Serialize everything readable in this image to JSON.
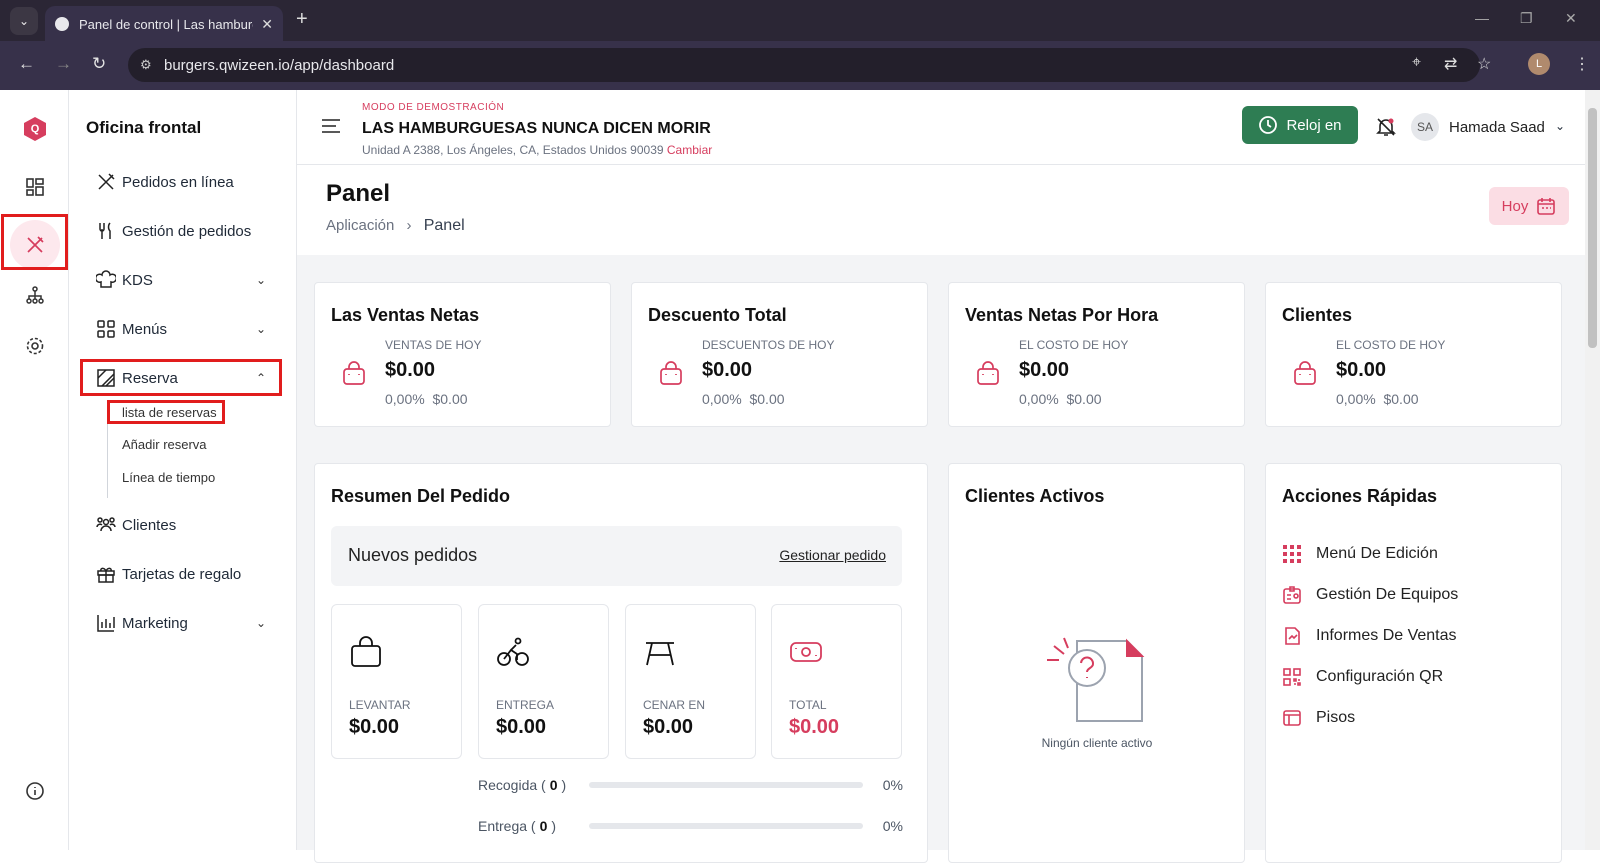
{
  "browser": {
    "tab_title": "Panel de control | Las hamburg",
    "url": "burgers.qwizeen.io/app/dashboard",
    "profile_initial": "L"
  },
  "rail": {
    "logo": "Q",
    "icons": [
      "dashboard-icon",
      "restaurant-icon",
      "organization-icon",
      "settings-icon",
      "info-icon"
    ]
  },
  "sidebar": {
    "heading": "Oficina frontal",
    "items": [
      {
        "label": "Pedidos en línea",
        "icon": "utensils-cross-icon"
      },
      {
        "label": "Gestión de pedidos",
        "icon": "fork-knife-icon"
      },
      {
        "label": "KDS",
        "icon": "chef-hat-icon"
      },
      {
        "label": "Menús",
        "icon": "grid-icon"
      },
      {
        "label": "Reserva",
        "icon": "reservation-icon"
      },
      {
        "label": "Clientes",
        "icon": "users-icon"
      },
      {
        "label": "Tarjetas de regalo",
        "icon": "gift-icon"
      },
      {
        "label": "Marketing",
        "icon": "chart-icon"
      }
    ],
    "reserva_sub": [
      "lista de reservas",
      "Añadir reserva",
      "Línea de tiempo"
    ]
  },
  "header": {
    "demo_mode": "MODO DE DEMOSTRACIÓN",
    "store_name": "LAS HAMBURGUESAS NUNCA DICEN MORIR",
    "address": "Unidad A 2388, Los Ángeles, CA, Estados Unidos 90039",
    "change": "Cambiar",
    "clock_in": "Reloj en",
    "user_initials": "SA",
    "user_name": "Hamada Saad"
  },
  "page": {
    "title": "Panel",
    "breadcrumb_root": "Aplicación",
    "breadcrumb_current": "Panel",
    "today": "Hoy"
  },
  "kpis": [
    {
      "title": "Las Ventas Netas",
      "label": "VENTAS DE HOY",
      "value": "$0.00",
      "pct": "0,00%",
      "prev": "$0.00"
    },
    {
      "title": "Descuento Total",
      "label": "DESCUENTOS DE HOY",
      "value": "$0.00",
      "pct": "0,00%",
      "prev": "$0.00"
    },
    {
      "title": "Ventas Netas Por Hora",
      "label": "EL COSTO DE HOY",
      "value": "$0.00",
      "pct": "0,00%",
      "prev": "$0.00"
    },
    {
      "title": "Clientes",
      "label": "EL COSTO DE HOY",
      "value": "$0.00",
      "pct": "0,00%",
      "prev": "$0.00"
    }
  ],
  "order_summary": {
    "title": "Resumen Del Pedido",
    "new_orders": "Nuevos pedidos",
    "manage": "Gestionar pedido",
    "types": [
      {
        "label": "LEVANTAR",
        "value": "$0.00"
      },
      {
        "label": "ENTREGA",
        "value": "$0.00"
      },
      {
        "label": "CENAR EN",
        "value": "$0.00"
      },
      {
        "label": "TOTAL",
        "value": "$0.00"
      }
    ],
    "progress": [
      {
        "label": "Recogida",
        "count": "0",
        "pct": "0%",
        "fraction": 0
      },
      {
        "label": "Entrega",
        "count": "0",
        "pct": "0%",
        "fraction": 0
      }
    ]
  },
  "active_clients": {
    "title": "Clientes Activos",
    "empty": "Ningún cliente activo"
  },
  "quick_actions": {
    "title": "Acciones Rápidas",
    "items": [
      "Menú De Edición",
      "Gestión De Equipos",
      "Informes De Ventas",
      "Configuración QR",
      "Pisos"
    ]
  },
  "colors": {
    "accent": "#d63d5e",
    "green": "#2e7d53",
    "highlight": "#e11d1d"
  }
}
